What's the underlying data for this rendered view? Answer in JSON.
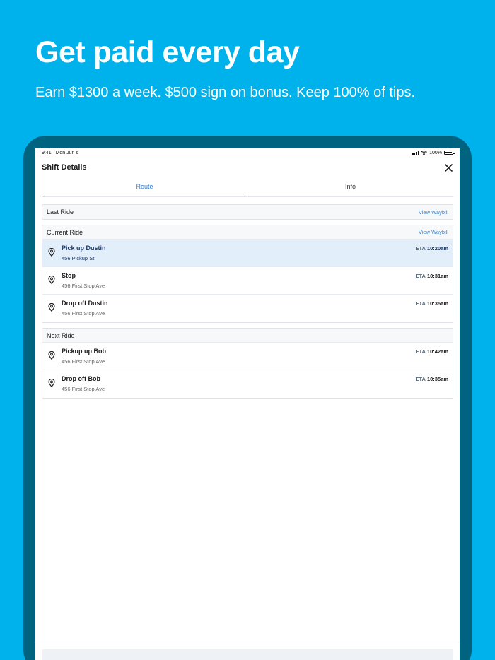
{
  "promo": {
    "headline": "Get paid every day",
    "subline": "Earn $1300 a week. $500 sign on bonus. Keep 100% of tips."
  },
  "status_bar": {
    "time": "9:41",
    "date": "Mon Jun 6",
    "battery": "100%"
  },
  "header": {
    "title": "Shift Details",
    "close_icon": "close-icon"
  },
  "tabs": [
    {
      "label": "Route",
      "active": true
    },
    {
      "label": "Info",
      "active": false
    }
  ],
  "sections": {
    "last_ride": {
      "title": "Last Ride",
      "action": "View Waybill"
    },
    "current_ride": {
      "title": "Current Ride",
      "action": "View Waybill",
      "stops": [
        {
          "title": "Pick up Dustin",
          "address": "456 Pickup St",
          "eta_label": "ETA",
          "eta_time": "10:20am",
          "highlighted": true
        },
        {
          "title": "Stop",
          "address": "456 First Stop Ave",
          "eta_label": "ETA",
          "eta_time": "10:31am",
          "highlighted": false
        },
        {
          "title": "Drop off Dustin",
          "address": "456 First Stop Ave",
          "eta_label": "ETA",
          "eta_time": "10:35am",
          "highlighted": false
        }
      ]
    },
    "next_ride": {
      "title": "Next Ride",
      "stops": [
        {
          "title": "Pickup up Bob",
          "address": "456 First Stop Ave",
          "eta_label": "ETA",
          "eta_time": "10:42am",
          "highlighted": false
        },
        {
          "title": "Drop off Bob",
          "address": "456 First Stop Ave",
          "eta_label": "ETA",
          "eta_time": "10:35am",
          "highlighted": false
        }
      ]
    }
  },
  "icons": {
    "stop_marker": "map-pin-icon"
  },
  "colors": {
    "background": "#00b2ec",
    "device_frame": "#006481",
    "accent": "#2f7fcf",
    "highlight_row": "#e3eefb"
  }
}
